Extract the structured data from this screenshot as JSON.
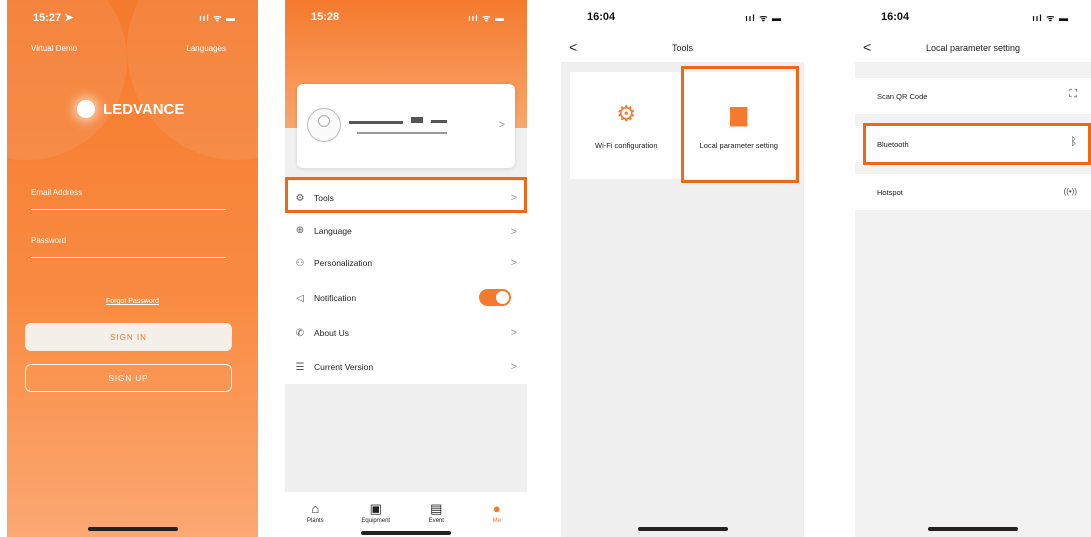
{
  "screen1": {
    "time": "15:27 ➤",
    "status_icons": "ııl ᯤ ▬",
    "virtual_demo": "Virtual Demo",
    "languages": "Languages",
    "brand": "LEDVANCE",
    "email_label": "Email Address",
    "password_label": "Password",
    "forgot": "Forgot Password",
    "sign_in": "SIGN IN",
    "sign_up": "SIGN UP"
  },
  "screen2": {
    "time": "15:28",
    "status_icons": "ııl ᯤ ▬",
    "menu": [
      {
        "label": "Tools",
        "icon": "⚙"
      },
      {
        "label": "Language",
        "icon": "⊕"
      },
      {
        "label": "Personalization",
        "icon": "⚇"
      },
      {
        "label": "Notification",
        "icon": "◁"
      },
      {
        "label": "About Us",
        "icon": "✆"
      },
      {
        "label": "Current Version",
        "icon": "☰"
      }
    ],
    "tabs": [
      {
        "label": "Plants",
        "icon": "⌂"
      },
      {
        "label": "Equipment",
        "icon": "▣"
      },
      {
        "label": "Event",
        "icon": "▤"
      },
      {
        "label": "Me",
        "icon": "●"
      }
    ],
    "notification_on": true,
    "accent": "#F47A2D"
  },
  "screen3": {
    "time": "16:04",
    "status_icons": "ııl ᯤ ▬",
    "title": "Tools",
    "tiles": [
      {
        "label": "Wi-Fi configuration",
        "icon": "⚙"
      },
      {
        "label": "Local parameter setting",
        "icon": "▆"
      }
    ]
  },
  "screen4": {
    "time": "16:04",
    "status_icons": "ııl ᯤ ▬",
    "title": "Local parameter setting",
    "rows": [
      {
        "label": "Scan QR Code",
        "icon": "⛶"
      },
      {
        "label": "Bluetooth",
        "icon": "ᛒ"
      },
      {
        "label": "Hotspot",
        "icon": "((•))"
      }
    ]
  },
  "highlight_color": "#EC6A15"
}
